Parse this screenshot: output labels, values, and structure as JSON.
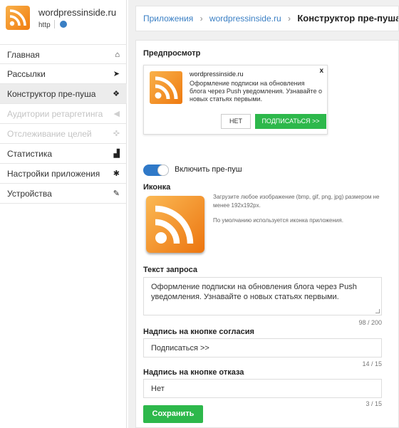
{
  "app": {
    "name": "wordpressinside.ru",
    "protocol": "http",
    "logo_icon": "rss-icon",
    "brand_color": "#f08a1c"
  },
  "sidebar": {
    "items": [
      {
        "label": "Главная",
        "icon": "home-icon",
        "glyph": "⌂",
        "state": "normal"
      },
      {
        "label": "Рассылки",
        "icon": "paper-plane-icon",
        "glyph": "➤",
        "state": "normal"
      },
      {
        "label": "Конструктор пре-пуша",
        "icon": "cubes-icon",
        "glyph": "❖",
        "state": "active"
      },
      {
        "label": "Аудитории ретаргетинга",
        "icon": "megaphone-icon",
        "glyph": "◀",
        "state": "disabled"
      },
      {
        "label": "Отслеживание целей",
        "icon": "crosshair-icon",
        "glyph": "✜",
        "state": "disabled"
      },
      {
        "label": "Статистика",
        "icon": "area-chart-icon",
        "glyph": "▟",
        "state": "normal"
      },
      {
        "label": "Настройки приложения",
        "icon": "gear-icon",
        "glyph": "✱",
        "state": "normal"
      },
      {
        "label": "Устройства",
        "icon": "plug-icon",
        "glyph": "✎",
        "state": "normal"
      }
    ]
  },
  "breadcrumb": {
    "items": [
      "Приложения",
      "wordpressinside.ru"
    ],
    "separator": "›",
    "current": "Конструктор пре-пуша"
  },
  "preview": {
    "title": "Предпросмотр",
    "site": "wordpressinside.ru",
    "text": "Оформление подписки на обновления блога через Push уведомления. Узнавайте о новых статьях первыми.",
    "close": "x",
    "decline": "НЕТ",
    "accept": "ПОДПИСАТЬСЯ >>"
  },
  "toggle": {
    "label": "Включить пре-пуш",
    "enabled": true,
    "color": "#2f79c8"
  },
  "icon_section": {
    "title": "Иконка",
    "hint": "Загрузите любое изображение (bmp, gif, png, jpg) размером не менее 192x192px.",
    "default_note": "По умолчанию используется иконка приложения."
  },
  "request_text": {
    "label": "Текст запроса",
    "value": "Оформление подписки на обновления блога через Push уведомления. Узнавайте о новых статьях первыми.",
    "counter": "98 / 200"
  },
  "accept_button": {
    "label": "Надпись на кнопке согласия",
    "value": "Подписаться >>",
    "counter": "14 / 15"
  },
  "decline_button": {
    "label": "Надпись на кнопке отказа",
    "value": "Нет",
    "counter": "3 / 15"
  },
  "save_label": "Сохранить",
  "accent_green": "#2db84b",
  "link_blue": "#3a7fc4"
}
